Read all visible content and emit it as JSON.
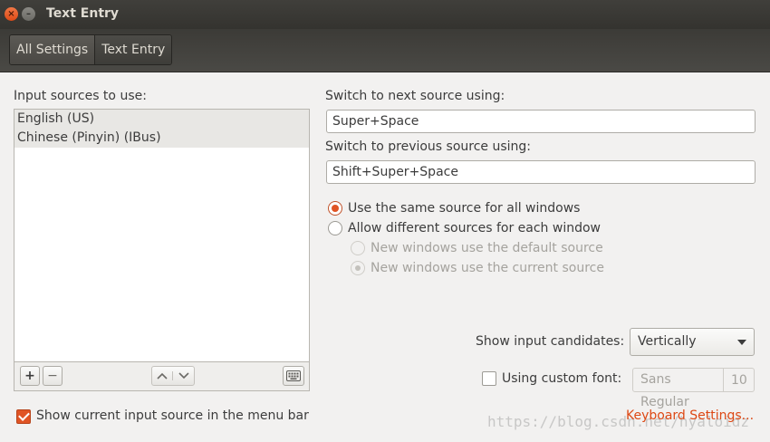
{
  "window": {
    "title": "Text Entry"
  },
  "toolbar": {
    "crumbs": [
      "All Settings",
      "Text Entry"
    ]
  },
  "input_sources": {
    "label": "Input sources to use:",
    "items": [
      "English (US)",
      "Chinese (Pinyin) (IBus)"
    ],
    "add_label": "+",
    "remove_label": "−",
    "up_label": "⌃",
    "down_label": "⌄"
  },
  "switching": {
    "next_label": "Switch to next source using:",
    "next_value": "Super+Space",
    "prev_label": "Switch to previous source using:",
    "prev_value": "Shift+Super+Space"
  },
  "source_mode": {
    "same_label": "Use the same source for all windows",
    "same_selected": true,
    "different_label": "Allow different sources for each window",
    "different_selected": false,
    "sub_default_label": "New windows use the default source",
    "sub_current_label": "New windows use the current source",
    "sub_current_selected": true
  },
  "candidates": {
    "label": "Show input candidates:",
    "value": "Vertically"
  },
  "custom_font": {
    "label": "Using custom font:",
    "checked": false,
    "font_name": "Sans Regular",
    "font_size": "10"
  },
  "menu_bar": {
    "label": "Show current input source in the menu bar",
    "checked": true
  },
  "links": {
    "keyboard_settings": "Keyboard Settings..."
  },
  "watermark": {
    "text": "https://blog.csdn.net/hyaloidz"
  },
  "colors": {
    "accent": "#e05424",
    "titlebar": "#3c3b37"
  }
}
